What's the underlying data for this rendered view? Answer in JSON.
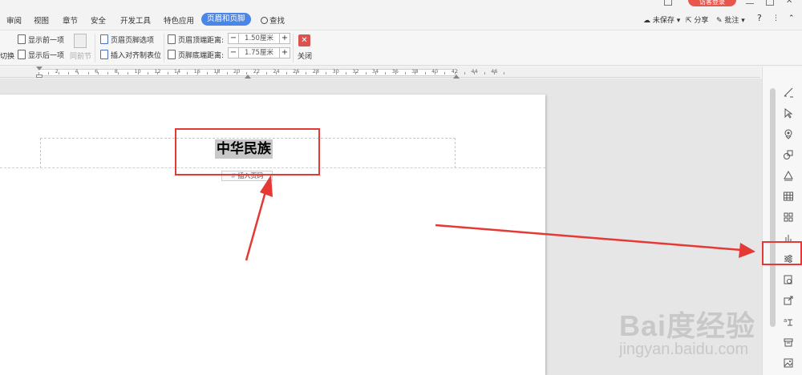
{
  "topbar": {
    "login_label": "访客登录"
  },
  "menu": {
    "tabs": [
      {
        "label": "审阅"
      },
      {
        "label": "视图"
      },
      {
        "label": "章节"
      },
      {
        "label": "安全"
      },
      {
        "label": "开发工具"
      },
      {
        "label": "特色应用"
      },
      {
        "label": "页眉和页脚",
        "active": true
      }
    ],
    "search_label": "查找",
    "right": {
      "unsaved": "未保存",
      "share": "分享",
      "comment": "批注",
      "help": "?"
    }
  },
  "ribbon": {
    "switch_label": "切换",
    "show_prev": "显示前一项",
    "show_next": "显示后一项",
    "same_as_prev": "同前节",
    "header_footer_options": "页眉页脚选项",
    "insert_align_tab": "插入对齐制表位",
    "header_top_distance_label": "页眉顶端距离:",
    "header_top_distance_value": "1.50厘米",
    "footer_bottom_distance_label": "页脚底端距离:",
    "footer_bottom_distance_value": "1.75厘米",
    "close_label": "关闭",
    "minus": "−",
    "plus": "+"
  },
  "ruler": {
    "numbers": [
      "2",
      "4",
      "6",
      "8",
      "10",
      "12",
      "14",
      "16",
      "18",
      "20",
      "22",
      "24",
      "26",
      "28",
      "30",
      "32",
      "34",
      "36",
      "38",
      "40",
      "42",
      "44",
      "46"
    ]
  },
  "document": {
    "header_text": "中华民族",
    "insert_page_number": "插入页码"
  },
  "sidebar": {
    "icons": [
      "pen-icon",
      "cursor-icon",
      "location-icon",
      "shapes-icon",
      "fill-icon",
      "table-icon",
      "grid-icon",
      "chart-icon",
      "settings-sliders-icon",
      "image-find-icon",
      "export-icon",
      "translate-icon",
      "archive-icon",
      "picture-icon"
    ]
  },
  "watermark": {
    "logo": "Bai度经验",
    "url": "jingyan.baidu.com"
  },
  "colors": {
    "accent": "#4a86e8",
    "annotation_red": "#e53935",
    "login_red": "#e8564d"
  }
}
